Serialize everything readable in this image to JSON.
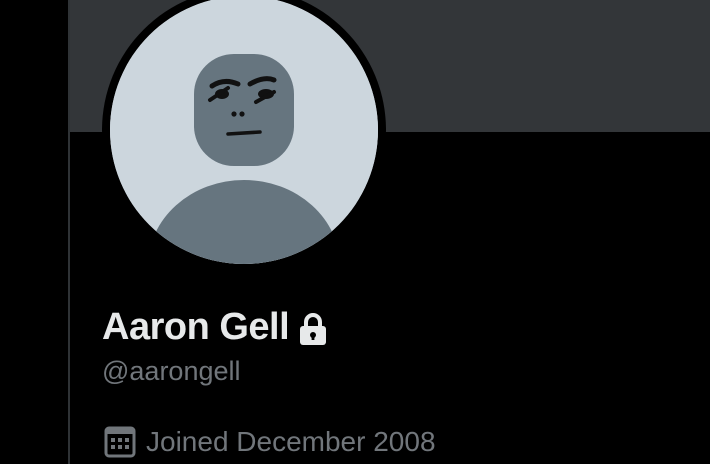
{
  "profile": {
    "display_name": "Aaron Gell",
    "handle": "@aarongell",
    "joined": "Joined December 2008",
    "protected": true
  },
  "icons": {
    "lock": "lock-icon",
    "calendar": "calendar-icon"
  },
  "colors": {
    "background": "#000000",
    "banner": "#333639",
    "avatar_bg": "#ccd6dd",
    "avatar_figure": "#66757f",
    "name_text": "#e7e9ea",
    "secondary_text": "#71767b"
  }
}
